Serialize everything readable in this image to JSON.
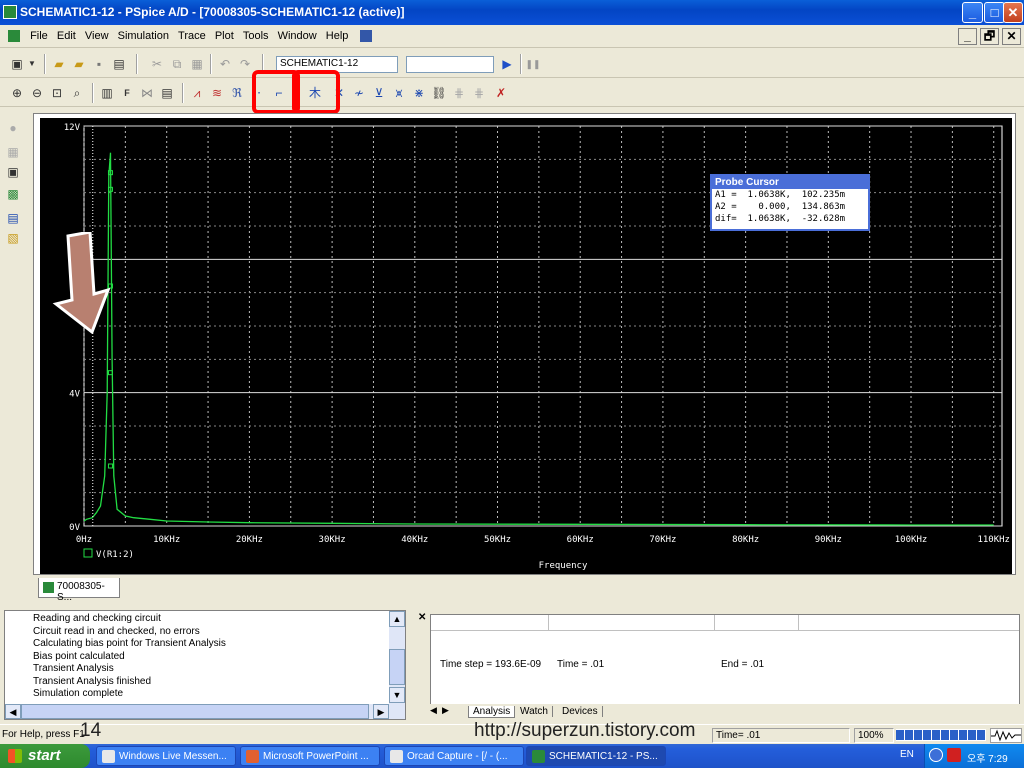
{
  "window": {
    "title": "SCHEMATIC1-12 - PSpice A/D  - [70008305-SCHEMATIC1-12 (active)]",
    "controls": {
      "minimize": "_",
      "maximize": "□",
      "close": "✕"
    }
  },
  "menu": [
    "File",
    "Edit",
    "View",
    "Simulation",
    "Trace",
    "Plot",
    "Tools",
    "Window",
    "Help"
  ],
  "mdi_controls": {
    "minimize": "_",
    "restore": "🗗",
    "close": "✕"
  },
  "toolbar": {
    "profile_combo_value": "SCHEMATIC1-12",
    "second_combo_value": "",
    "run_symbol": "▶",
    "pause_symbol": "❚❚"
  },
  "plot": {
    "y_ticks": [
      "12V",
      "4V",
      "0V"
    ],
    "x_ticks": [
      "0Hz",
      "10KHz",
      "20KHz",
      "30KHz",
      "40KHz",
      "50KHz",
      "60KHz",
      "70KHz",
      "80KHz",
      "90KHz",
      "100KHz",
      "110KHz"
    ],
    "x_label": "Frequency",
    "trace_legend": "V(R1:2)",
    "trace_color": "#22dd44"
  },
  "probe_cursor": {
    "title": "Probe Cursor",
    "rows": [
      "A1 =  1.0638K,  102.235m",
      "A2 =    0.000,  134.863m",
      "dif=  1.0638K,  -32.628m"
    ]
  },
  "plot_tab": "70008305-S...",
  "output_log": [
    "Reading and checking circuit",
    "Circuit read in and checked, no errors",
    "Calculating bias point for Transient Analysis",
    "Bias point calculated",
    "Transient Analysis",
    "Transient Analysis finished",
    "Simulation complete"
  ],
  "sim_status": {
    "time_step": "Time step =  193.6E-09",
    "time": "Time =  .01",
    "end": "End =  .01"
  },
  "sim_tabs": [
    "Analysis",
    "Watch",
    "Devices"
  ],
  "statusbar": {
    "help": "For Help, press F1",
    "time": "Time= .01",
    "zoom": "100%",
    "progress_fraction": 1.0
  },
  "overlay": {
    "slide_number": "14",
    "url": "http://superzun.tistory.com"
  },
  "taskbar": {
    "start": "start",
    "tasks": [
      "Windows Live Messen...",
      "Microsoft PowerPoint ...",
      "Orcad Capture - [/ - (...",
      "SCHEMATIC1-12 - PS..."
    ],
    "lang": "EN",
    "clock": "오후 7:29"
  },
  "colors": {
    "highlight": "#ff0000",
    "arrow": "#b88070",
    "probe_header": "#4a6ed8"
  }
}
